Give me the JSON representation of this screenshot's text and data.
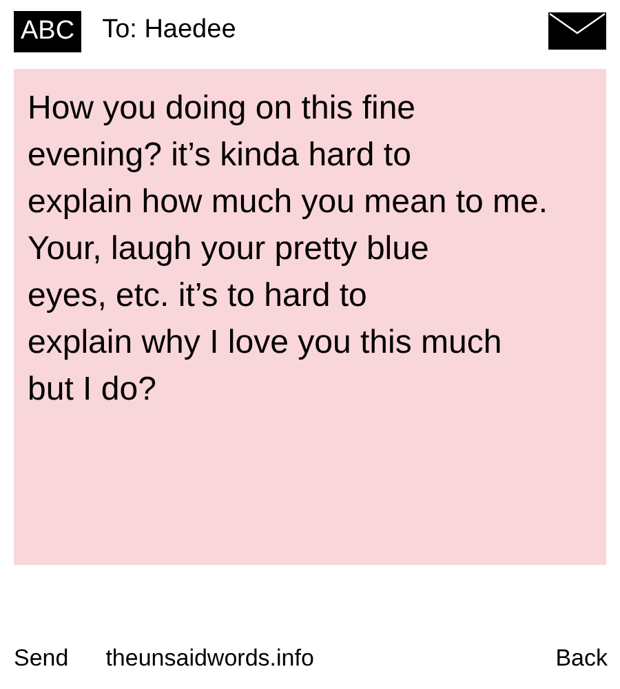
{
  "header": {
    "input_mode": "ABC",
    "recipient": "To: Haedee"
  },
  "message": "How you doing on this fine\nevening? it’s kinda hard to\nexplain how much you mean to me.\nYour, laugh your pretty blue\neyes, etc. it’s to hard to\nexplain why I love you this much\nbut I do?",
  "footer": {
    "left": "Send",
    "center": "theunsaidwords.info",
    "right": "Back"
  }
}
